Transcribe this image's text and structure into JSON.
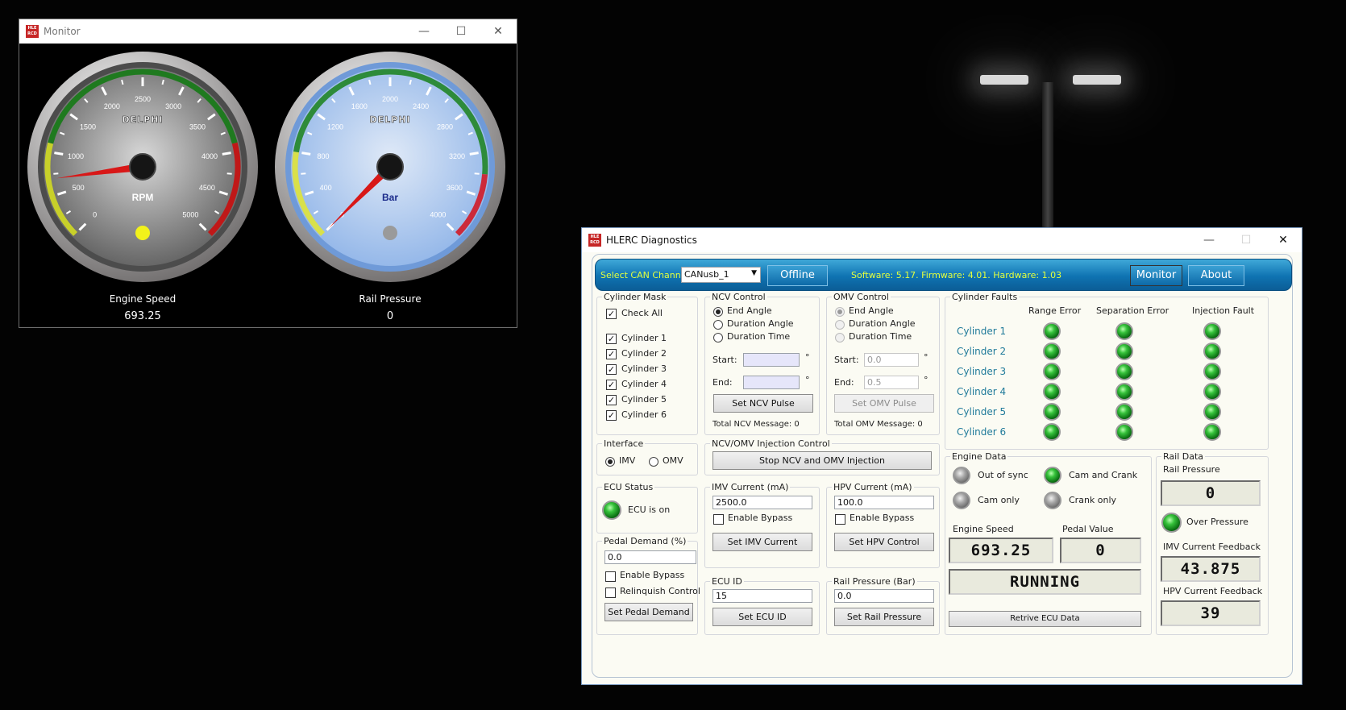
{
  "monitor": {
    "title": "Monitor",
    "app_icon_text": "HLE RCD",
    "gauges": [
      {
        "brand": "DELPHI",
        "unit": "RPM",
        "label": "Engine Speed",
        "value": "693.25",
        "min": 0,
        "max": 5000,
        "ticks": [
          "0",
          "500",
          "1000",
          "1500",
          "2000",
          "2500",
          "3000",
          "3500",
          "4000",
          "4500",
          "5000"
        ],
        "needle_value": 693.25,
        "face_color": "#5c5c5c"
      },
      {
        "brand": "DELPHI",
        "unit": "Bar",
        "label": "Rail Pressure",
        "value": "0",
        "min": 0,
        "max": 4000,
        "ticks": [
          "0",
          "400",
          "800",
          "1200",
          "1600",
          "2000",
          "2400",
          "2800",
          "3200",
          "3600",
          "4000"
        ],
        "needle_value": 0,
        "face_color": "#8fb4e8"
      }
    ]
  },
  "diag": {
    "title": "HLERC Diagnostics",
    "app_icon_text": "HLE RCD",
    "toolbar": {
      "channel_label": "Select CAN Channel",
      "channel_value": "CANusb_1",
      "offline_button": "Offline",
      "version_text": "Software: 5.17. Firmware: 4.01. Hardware: 1.03",
      "monitor_button": "Monitor",
      "about_button": "About"
    },
    "cylinder_mask": {
      "title": "Cylinder Mask",
      "check_all": "Check All",
      "cylinders": [
        "Cylinder 1",
        "Cylinder 2",
        "Cylinder 3",
        "Cylinder 4",
        "Cylinder 5",
        "Cylinder 6"
      ]
    },
    "ncv": {
      "title": "NCV Control",
      "options": [
        "End Angle",
        "Duration Angle",
        "Duration Time"
      ],
      "start_label": "Start:",
      "end_label": "End:",
      "start_value": "",
      "end_value": "",
      "unit": "°",
      "button": "Set NCV Pulse",
      "total": "Total NCV Message: 0"
    },
    "omv": {
      "title": "OMV Control",
      "options": [
        "End Angle",
        "Duration Angle",
        "Duration Time"
      ],
      "start_label": "Start:",
      "end_label": "End:",
      "start_value": "0.0",
      "end_value": "0.5",
      "unit": "°",
      "button": "Set OMV Pulse",
      "total": "Total OMV Message: 0"
    },
    "faults": {
      "title": "Cylinder Faults",
      "columns": [
        "Range Error",
        "Separation Error",
        "Injection Fault"
      ],
      "rows": [
        "Cylinder 1",
        "Cylinder 2",
        "Cylinder 3",
        "Cylinder 4",
        "Cylinder 5",
        "Cylinder 6"
      ]
    },
    "interface": {
      "title": "Interface",
      "imv": "IMV",
      "omv": "OMV"
    },
    "injection": {
      "title": "NCV/OMV Injection Control",
      "button": "Stop NCV and OMV Injection"
    },
    "ecu_status": {
      "title": "ECU Status",
      "text": "ECU is on"
    },
    "imv_current": {
      "title": "IMV Current (mA)",
      "value": "2500.0",
      "bypass": "Enable Bypass",
      "button": "Set IMV Current"
    },
    "hpv_current": {
      "title": "HPV Current (mA)",
      "value": "100.0",
      "bypass": "Enable Bypass",
      "button": "Set HPV Control"
    },
    "pedal": {
      "title": "Pedal Demand (%)",
      "value": "0.0",
      "bypass": "Enable Bypass",
      "relinquish": "Relinquish Control",
      "button": "Set Pedal Demand"
    },
    "ecu_id": {
      "title": "ECU ID",
      "value": "15",
      "button": "Set ECU ID"
    },
    "rail_set": {
      "title": "Rail Pressure (Bar)",
      "value": "0.0",
      "button": "Set Rail Pressure"
    },
    "engine_data": {
      "title": "Engine Data",
      "out_of_sync": "Out of sync",
      "cam_and_crank": "Cam and Crank",
      "cam_only": "Cam only",
      "crank_only": "Crank only",
      "speed_label": "Engine Speed",
      "pedal_label": "Pedal Value",
      "speed_value": "693.25",
      "pedal_value": "0",
      "state": "RUNNING",
      "button": "Retrive ECU Data"
    },
    "rail_data": {
      "title": "Rail Data",
      "pressure_label": "Rail Pressure",
      "pressure_value": "0",
      "over_pressure": "Over Pressure",
      "imv_fb_label": "IMV Current Feedback",
      "imv_fb_value": "43.875",
      "hpv_fb_label": "HPV Current Feedback",
      "hpv_fb_value": "39"
    }
  }
}
